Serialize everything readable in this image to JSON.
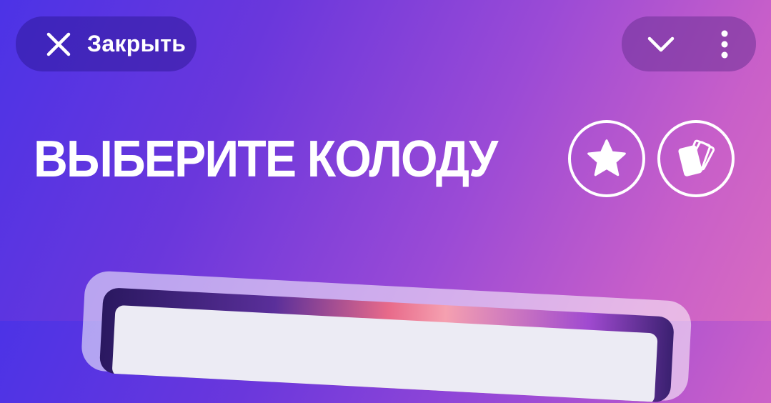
{
  "header": {
    "close_label": "Закрыть",
    "close_icon": "close-icon",
    "collapse_icon": "chevron-down-icon",
    "menu_icon": "more-vertical-icon"
  },
  "main": {
    "title": "ВЫБЕРИТЕ КОЛОДУ",
    "actions": [
      {
        "name": "favorites",
        "icon": "star-icon"
      },
      {
        "name": "decks",
        "icon": "cards-icon"
      }
    ]
  },
  "colors": {
    "gradient_start": "#4c33e6",
    "gradient_end": "#d86bc0",
    "text": "#ffffff"
  }
}
